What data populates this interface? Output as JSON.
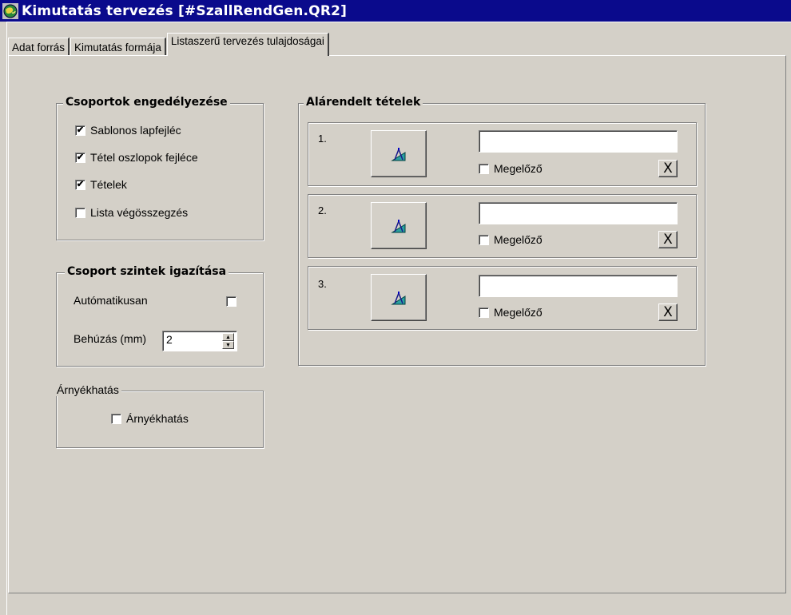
{
  "window": {
    "title": "Kimutatás tervezés [#SzallRendGen.QR2]",
    "icon": "globe-app-icon"
  },
  "tabs": [
    {
      "label": "Adat forrás"
    },
    {
      "label": "Kimutatás formája"
    },
    {
      "label": "Listaszerű tervezés tulajdoságai"
    }
  ],
  "groups_enable": {
    "title": "Csoportok engedélyezése",
    "items": [
      {
        "label": "Sablonos lapfejléc",
        "checked": true
      },
      {
        "label": "Tétel oszlopok fejléce",
        "checked": true
      },
      {
        "label": "Tételek",
        "checked": true
      },
      {
        "label": "Lista végösszegzés",
        "checked": false
      }
    ]
  },
  "group_levels": {
    "title": "Csoport szintek igazítása",
    "auto_label": "Autómatikusan",
    "auto_checked": false,
    "indent_label": "Behúzás (mm)",
    "indent_value": "2"
  },
  "shadow": {
    "title": "Árnyékhatás",
    "checkbox_label": "Árnyékhatás",
    "checked": false
  },
  "subitems": {
    "title": "Alárendelt tételek",
    "rows": [
      {
        "number": "1.",
        "field_value": "",
        "prev_label": "Megelőző",
        "prev_checked": false,
        "clear_label": "X"
      },
      {
        "number": "2.",
        "field_value": "",
        "prev_label": "Megelőző",
        "prev_checked": false,
        "clear_label": "X"
      },
      {
        "number": "3.",
        "field_value": "",
        "prev_label": "Megelőző",
        "prev_checked": false,
        "clear_label": "X"
      }
    ]
  },
  "colors": {
    "titlebar": "#0a0a8c",
    "face": "#d4d0c8"
  }
}
